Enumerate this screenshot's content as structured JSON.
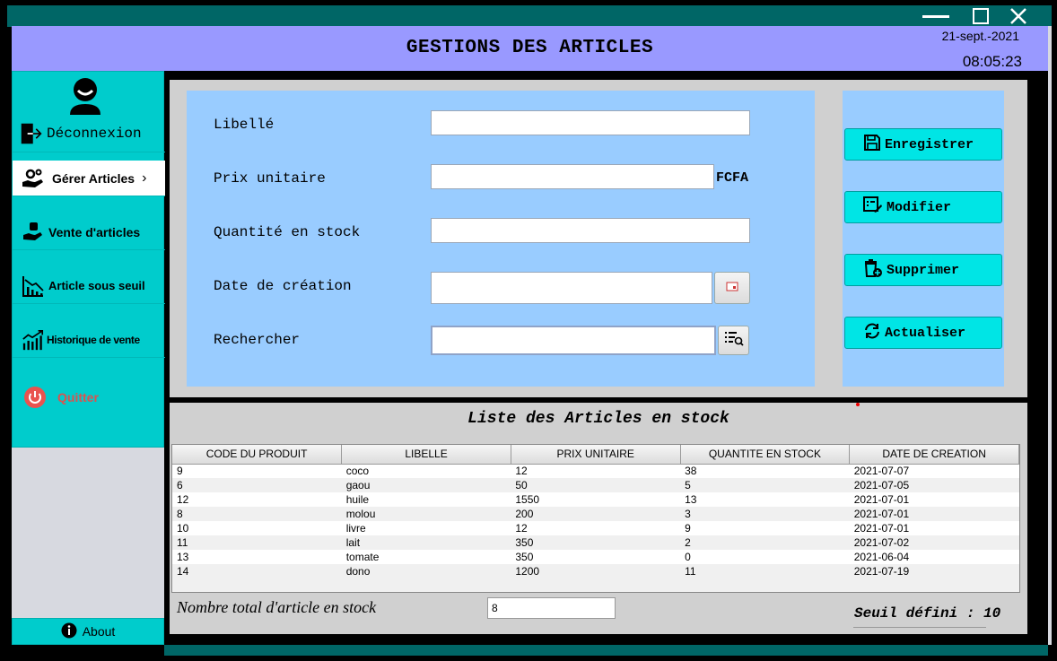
{
  "window": {
    "minimize": "minimize",
    "maximize": "maximize",
    "close": "close"
  },
  "header": {
    "title": "GESTIONS DES ARTICLES",
    "date": "21-sept.-2021",
    "time": "08:05:23"
  },
  "sidebar": {
    "items": [
      {
        "label": "Déconnexion",
        "icon": "logout-icon"
      },
      {
        "label": "Gérer Articles",
        "icon": "manage-articles-icon"
      },
      {
        "label": "Vente d'articles",
        "icon": "sale-icon"
      },
      {
        "label": "Article sous seuil",
        "icon": "low-stock-chart-icon"
      },
      {
        "label": "Historique de vente",
        "icon": "sales-history-chart-icon"
      },
      {
        "label": "Quitter",
        "icon": "power-icon"
      }
    ],
    "about": "About"
  },
  "form": {
    "libelle_label": "Libellé",
    "prix_label": "Prix unitaire",
    "currency": "FCFA",
    "quantite_label": "Quantité en stock",
    "date_label": "Date de création",
    "recherche_label": "Rechercher",
    "libelle_value": "",
    "prix_value": "",
    "quantite_value": "",
    "date_value": "",
    "recherche_value": ""
  },
  "actions": {
    "save": "Enregistrer",
    "edit": "Modifier",
    "delete": "Supprimer",
    "refresh": "Actualiser"
  },
  "list": {
    "title": "Liste des Articles en stock",
    "columns": [
      "CODE DU PRODUIT",
      "LIBELLE",
      "PRIX UNITAIRE",
      "QUANTITE EN STOCK",
      "DATE DE CREATION"
    ],
    "rows": [
      [
        "9",
        "coco",
        "12",
        "38",
        "2021-07-07"
      ],
      [
        "6",
        "gaou",
        "50",
        "5",
        "2021-07-05"
      ],
      [
        "12",
        "huile",
        "1550",
        "13",
        "2021-07-01"
      ],
      [
        "8",
        "molou",
        "200",
        "3",
        "2021-07-01"
      ],
      [
        "10",
        "livre",
        "12",
        "9",
        "2021-07-01"
      ],
      [
        "11",
        "lait",
        "350",
        "2",
        "2021-07-02"
      ],
      [
        "13",
        "tomate",
        "350",
        "0",
        "2021-06-04"
      ],
      [
        "14",
        "dono",
        "1200",
        "11",
        "2021-07-19"
      ]
    ],
    "count_label": "Nombre total d'article en stock",
    "count_value": "8",
    "threshold": "Seuil défini  :  10"
  },
  "colors": {
    "titlebar": "#006666",
    "header": "#9999ff",
    "sidebar": "#00cccc",
    "form_panel": "#99ccff",
    "action_button": "#00e5e5",
    "quit_text": "#d9534f"
  }
}
